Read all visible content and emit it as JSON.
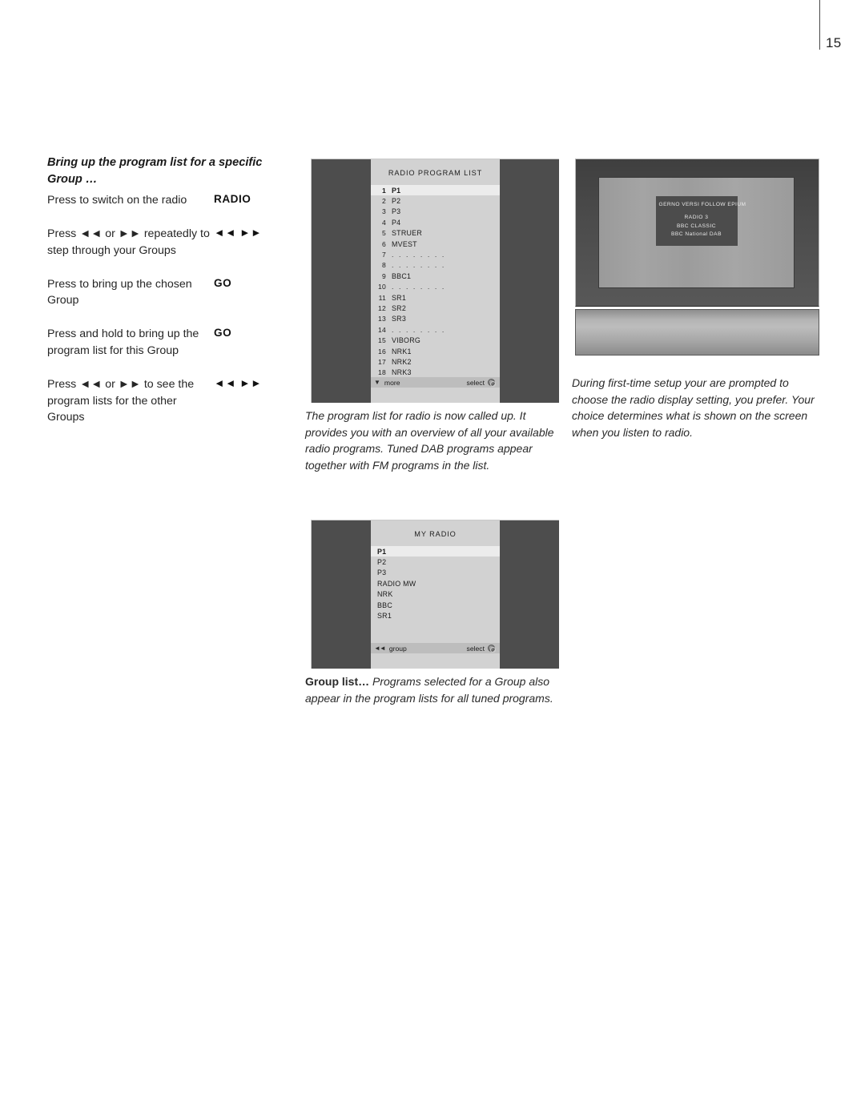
{
  "page": {
    "number": "15"
  },
  "instructions": {
    "heading": "Bring up the program list for a specific Group …",
    "rows": [
      {
        "text": "Press to switch on the radio",
        "key": "RADIO",
        "key_type": "text"
      },
      {
        "text": "Press ◄◄ or ►► repeatedly to step through your Groups",
        "key": "◄◄  ►►",
        "key_type": "glyph"
      },
      {
        "text": "Press to bring up the chosen Group",
        "key": "GO",
        "key_type": "text"
      },
      {
        "text": "Press and hold to bring up the program list for this Group",
        "key": "GO",
        "key_type": "text"
      },
      {
        "text": "Press ◄◄ or ►► to see the program lists for the other Groups",
        "key": "◄◄  ►►",
        "key_type": "glyph"
      }
    ]
  },
  "radio_program_list": {
    "title": "RADIO  PROGRAM  LIST",
    "items": [
      {
        "num": "1",
        "name": "P1",
        "selected": true
      },
      {
        "num": "2",
        "name": "P2",
        "selected": false
      },
      {
        "num": "3",
        "name": "P3",
        "selected": false
      },
      {
        "num": "4",
        "name": "P4",
        "selected": false
      },
      {
        "num": "5",
        "name": "STRUER",
        "selected": false
      },
      {
        "num": "6",
        "name": "MVEST",
        "selected": false
      },
      {
        "num": "7",
        "name": ". . . . . . . .",
        "selected": false
      },
      {
        "num": "8",
        "name": ". . . . . . . .",
        "selected": false
      },
      {
        "num": "9",
        "name": "BBC1",
        "selected": false
      },
      {
        "num": "10",
        "name": ". . . . . . . .",
        "selected": false
      },
      {
        "num": "11",
        "name": "SR1",
        "selected": false
      },
      {
        "num": "12",
        "name": "SR2",
        "selected": false
      },
      {
        "num": "13",
        "name": "SR3",
        "selected": false
      },
      {
        "num": "14",
        "name": ". . . . . . . .",
        "selected": false
      },
      {
        "num": "15",
        "name": "VIBORG",
        "selected": false
      },
      {
        "num": "16",
        "name": "NRK1",
        "selected": false
      },
      {
        "num": "17",
        "name": "NRK2",
        "selected": false
      },
      {
        "num": "18",
        "name": "NRK3",
        "selected": false
      }
    ],
    "footer": {
      "arrow": "▼",
      "left_label": "more",
      "right_label": "select",
      "go_icon": "go-button-icon"
    },
    "caption": "The program list for radio is now called up. It provides you with an overview of all your available radio programs. Tuned DAB programs appear together with FM programs in the list."
  },
  "my_radio_list": {
    "title": "MY  RADIO",
    "items": [
      {
        "name": "P1",
        "selected": true
      },
      {
        "name": "P2",
        "selected": false
      },
      {
        "name": "P3",
        "selected": false
      },
      {
        "name": "RADIO MW",
        "selected": false
      },
      {
        "name": "NRK",
        "selected": false
      },
      {
        "name": "BBC",
        "selected": false
      },
      {
        "name": "SR1",
        "selected": false
      }
    ],
    "footer": {
      "arrow": "◄◄",
      "left_label": "group",
      "right_label": "select",
      "go_icon": "go-button-icon"
    },
    "caption_lead": "Group list…",
    "caption_rest": " Programs selected for a Group also appear in the program lists for all tuned programs."
  },
  "tv_illustration": {
    "osd": {
      "heading": "GERNO VERSI FOLLOW EPIUM",
      "lines": [
        "RADIO  3",
        "BBC  CLASSIC",
        "BBC National DAB"
      ]
    },
    "caption": "During first-time setup your are prompted to choose the radio display setting, you prefer. Your choice determines what is shown on the screen when you listen to radio."
  },
  "colors": {
    "screen_bg": "#4d4d4d",
    "list_bg": "#d2d2d2",
    "list_selected": "#ececec",
    "footer_bg": "#bdbdbd",
    "osd_bg": "#4c4c4c"
  }
}
